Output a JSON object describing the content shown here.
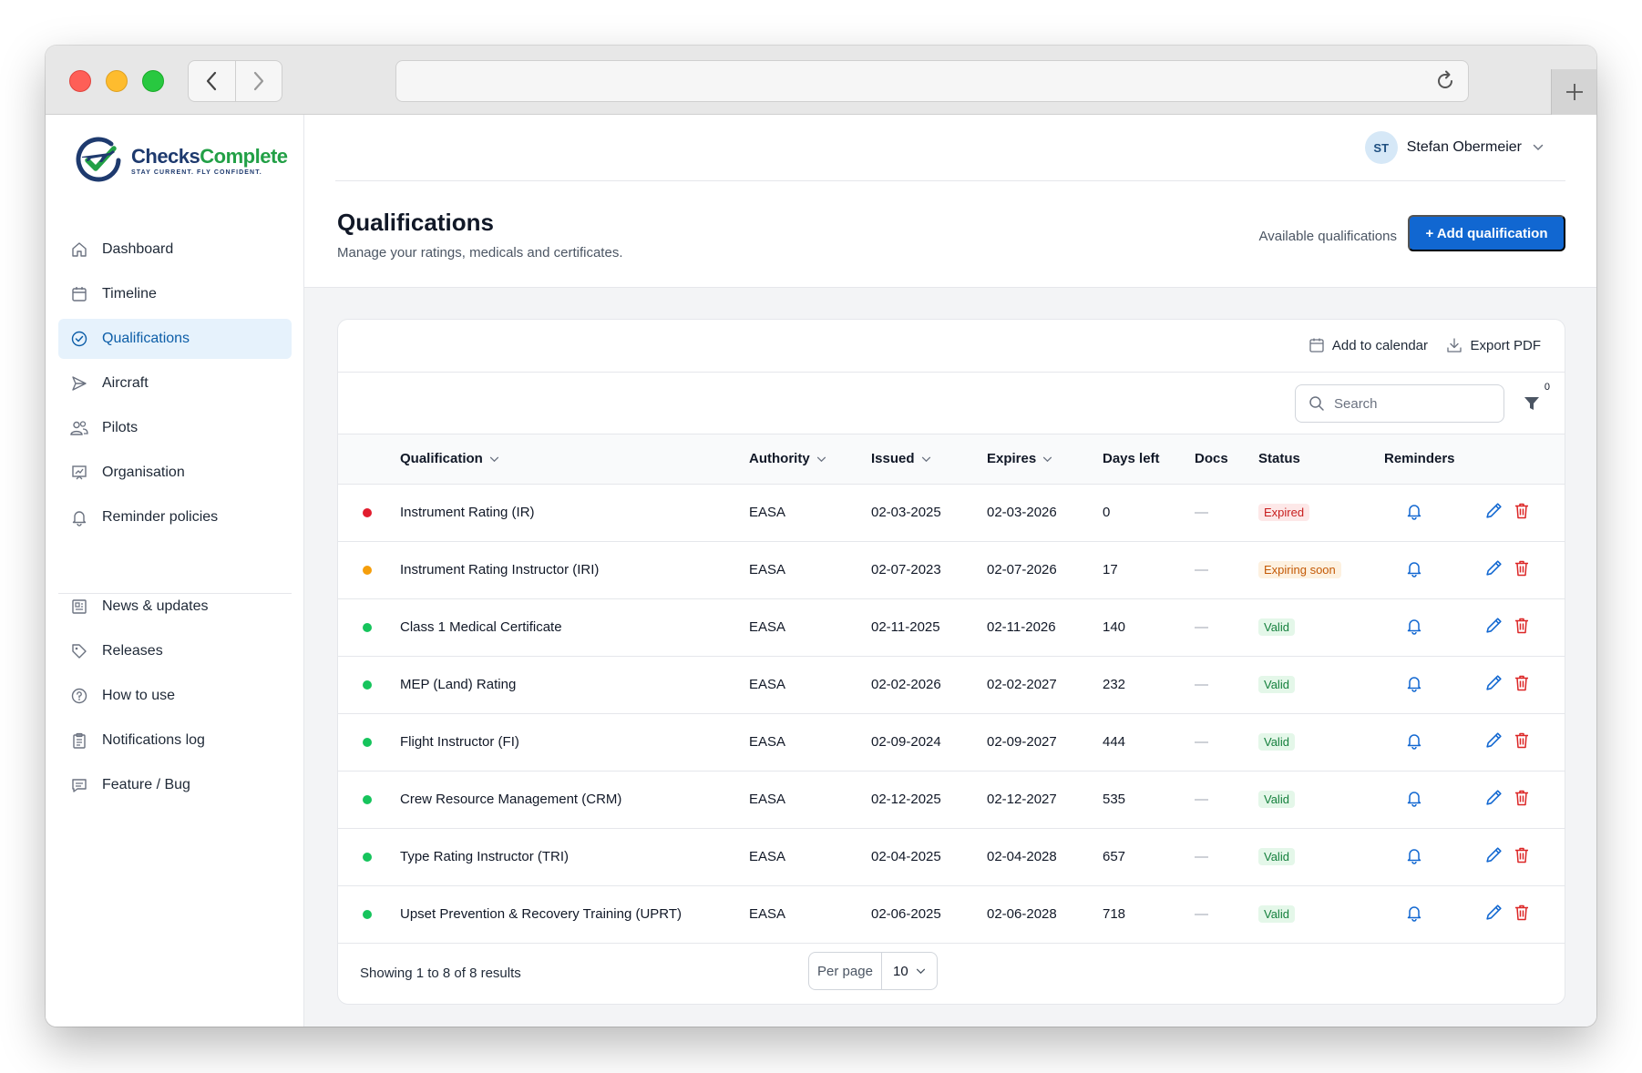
{
  "brand": {
    "name_part1": "Checks",
    "name_part2": "Complete",
    "tagline": "STAY CURRENT. FLY CONFIDENT."
  },
  "sidebar": {
    "primary": [
      {
        "label": "Dashboard",
        "icon": "home-icon"
      },
      {
        "label": "Timeline",
        "icon": "calendar-icon"
      },
      {
        "label": "Qualifications",
        "icon": "check-circle-icon",
        "active": true
      },
      {
        "label": "Aircraft",
        "icon": "paper-plane-icon"
      },
      {
        "label": "Pilots",
        "icon": "users-icon"
      },
      {
        "label": "Organisation",
        "icon": "chart-board-icon"
      },
      {
        "label": "Reminder policies",
        "icon": "bell-icon"
      }
    ],
    "secondary": [
      {
        "label": "News & updates",
        "icon": "newspaper-icon"
      },
      {
        "label": "Releases",
        "icon": "tag-icon"
      },
      {
        "label": "How to use",
        "icon": "question-circle-icon"
      },
      {
        "label": "Notifications log",
        "icon": "clipboard-icon"
      },
      {
        "label": "Feature / Bug",
        "icon": "chat-bubble-icon"
      }
    ]
  },
  "user": {
    "initials": "ST",
    "name": "Stefan Obermeier"
  },
  "page": {
    "title": "Qualifications",
    "subtitle": "Manage your ratings, medicals and certificates.",
    "available_link": "Available qualifications",
    "add_button": "+ Add qualification"
  },
  "toolbar": {
    "add_calendar": "Add to calendar",
    "export_pdf": "Export PDF",
    "search_placeholder": "Search",
    "filter_count": "0"
  },
  "table": {
    "headers": {
      "qualification": "Qualification",
      "authority": "Authority",
      "issued": "Issued",
      "expires": "Expires",
      "days_left": "Days left",
      "docs": "Docs",
      "status": "Status",
      "reminders": "Reminders"
    },
    "rows": [
      {
        "name": "Instrument Rating (IR)",
        "authority": "EASA",
        "issued": "02-03-2025",
        "expires": "02-03-2026",
        "days_left": "0",
        "docs": "—",
        "status": "Expired",
        "status_kind": "expired",
        "dot_color": "#e11d2e"
      },
      {
        "name": "Instrument Rating Instructor (IRI)",
        "authority": "EASA",
        "issued": "02-07-2023",
        "expires": "02-07-2026",
        "days_left": "17",
        "docs": "—",
        "status": "Expiring soon",
        "status_kind": "soon",
        "dot_color": "#f59e0b"
      },
      {
        "name": "Class 1 Medical Certificate",
        "authority": "EASA",
        "issued": "02-11-2025",
        "expires": "02-11-2026",
        "days_left": "140",
        "docs": "—",
        "status": "Valid",
        "status_kind": "valid",
        "dot_color": "#16c45c"
      },
      {
        "name": "MEP (Land) Rating",
        "authority": "EASA",
        "issued": "02-02-2026",
        "expires": "02-02-2027",
        "days_left": "232",
        "docs": "—",
        "status": "Valid",
        "status_kind": "valid",
        "dot_color": "#16c45c"
      },
      {
        "name": "Flight Instructor (FI)",
        "authority": "EASA",
        "issued": "02-09-2024",
        "expires": "02-09-2027",
        "days_left": "444",
        "docs": "—",
        "status": "Valid",
        "status_kind": "valid",
        "dot_color": "#16c45c"
      },
      {
        "name": "Crew Resource Management (CRM)",
        "authority": "EASA",
        "issued": "02-12-2025",
        "expires": "02-12-2027",
        "days_left": "535",
        "docs": "—",
        "status": "Valid",
        "status_kind": "valid",
        "dot_color": "#16c45c"
      },
      {
        "name": "Type Rating Instructor (TRI)",
        "authority": "EASA",
        "issued": "02-04-2025",
        "expires": "02-04-2028",
        "days_left": "657",
        "docs": "—",
        "status": "Valid",
        "status_kind": "valid",
        "dot_color": "#16c45c"
      },
      {
        "name": "Upset Prevention & Recovery Training (UPRT)",
        "authority": "EASA",
        "issued": "02-06-2025",
        "expires": "02-06-2028",
        "days_left": "718",
        "docs": "—",
        "status": "Valid",
        "status_kind": "valid",
        "dot_color": "#16c45c"
      }
    ]
  },
  "footer": {
    "results": "Showing 1 to 8 of 8 results",
    "per_page_label": "Per page",
    "per_page_value": "10"
  },
  "colors": {
    "accent": "#1167d1",
    "active_nav_bg": "#e6f2fc",
    "delete": "#dc2626"
  }
}
